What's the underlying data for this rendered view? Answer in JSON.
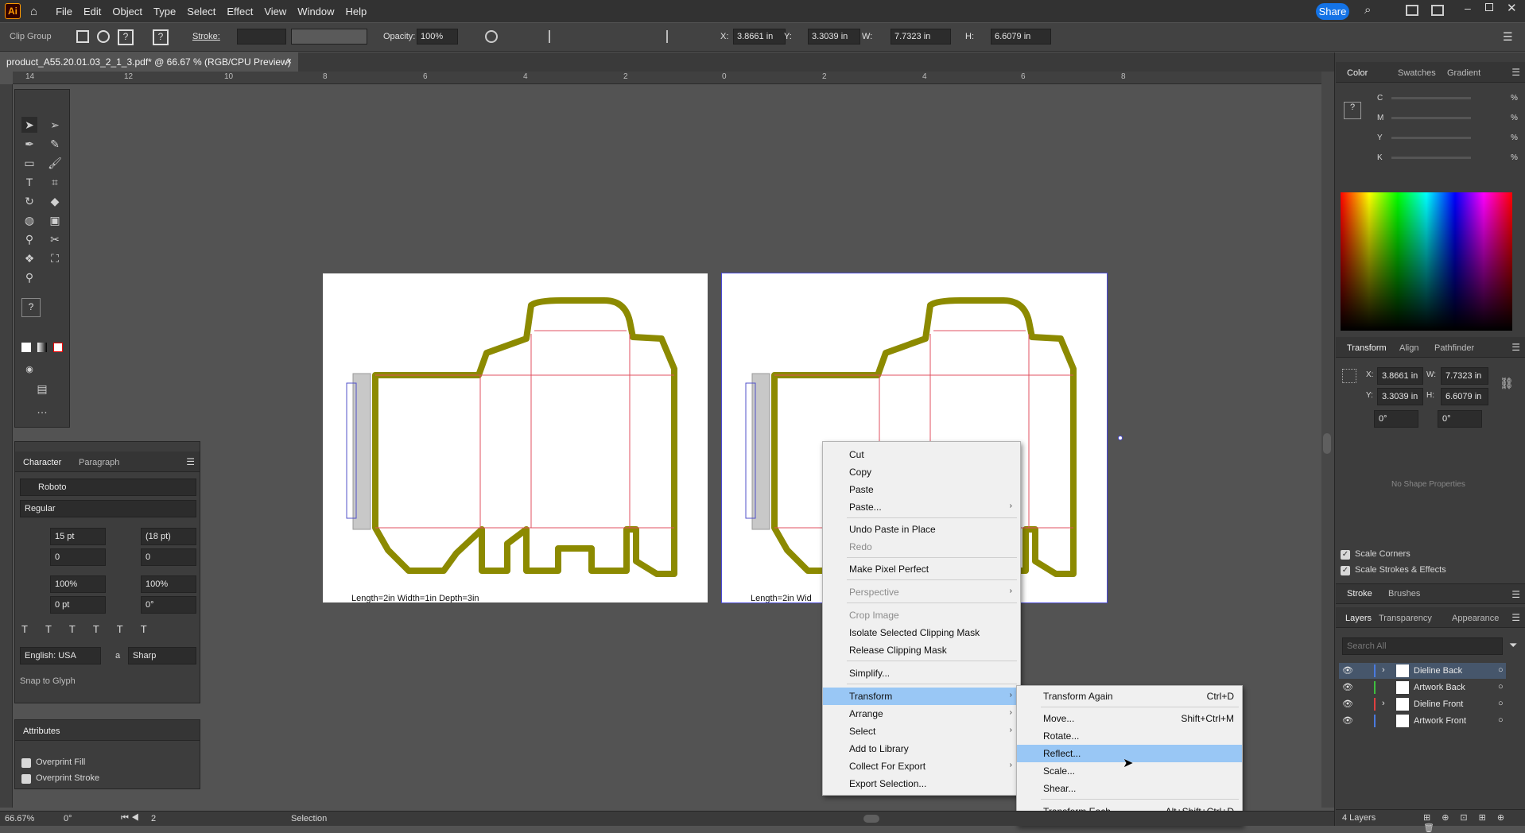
{
  "app": {
    "logo": "Ai",
    "share": "Share"
  },
  "menu": [
    "File",
    "Edit",
    "Object",
    "Type",
    "Select",
    "Effect",
    "View",
    "Window",
    "Help"
  ],
  "control": {
    "selection": "Clip Group",
    "stroke_label": "Stroke:",
    "opacity_label": "Opacity:",
    "opacity": "100%",
    "x_label": "X:",
    "x": "3.8661 in",
    "y_label": "Y:",
    "y": "3.3039 in",
    "w_label": "W:",
    "w": "7.7323 in",
    "h_label": "H:",
    "h": "6.6079 in"
  },
  "document": {
    "tab": "product_A55.20.01.03_2_1_3.pdf* @ 66.67 % (RGB/CPU Preview)",
    "close": "×"
  },
  "ruler": [
    "14",
    "12",
    "10",
    "8",
    "6",
    "4",
    "2",
    "0",
    "2",
    "4",
    "6",
    "8"
  ],
  "character": {
    "tabs": [
      "Character",
      "Paragraph"
    ],
    "font": "Roboto",
    "style": "Regular",
    "size": "15 pt",
    "leading": "(18 pt)",
    "kerning": "0",
    "tracking": "0",
    "vscale": "100%",
    "hscale": "100%",
    "baseline": "0 pt",
    "rotation": "0°",
    "language": "English: USA",
    "aa_label": "a",
    "antialias": "Sharp",
    "snap": "Snap to Glyph"
  },
  "attributes": {
    "title": "Attributes",
    "overprint_fill": "Overprint Fill",
    "overprint_stroke": "Overprint Stroke"
  },
  "artboard": {
    "caption": "Length=2in Width=1in Depth=3in",
    "caption2": "Length=2in Wid"
  },
  "context_menu": {
    "items": [
      "Cut",
      "Copy",
      "Paste",
      "Paste...",
      "Undo Paste in Place",
      "Redo",
      "Make Pixel Perfect",
      "Perspective",
      "Crop Image",
      "Isolate Selected Clipping Mask",
      "Release Clipping Mask",
      "Simplify...",
      "Transform",
      "Arrange",
      "Select",
      "Add to Library",
      "Collect For Export",
      "Export Selection..."
    ]
  },
  "submenu": {
    "items": [
      {
        "label": "Transform Again",
        "shortcut": "Ctrl+D"
      },
      {
        "label": "Move...",
        "shortcut": "Shift+Ctrl+M"
      },
      {
        "label": "Rotate...",
        "shortcut": ""
      },
      {
        "label": "Reflect...",
        "shortcut": ""
      },
      {
        "label": "Scale...",
        "shortcut": ""
      },
      {
        "label": "Shear...",
        "shortcut": ""
      },
      {
        "label": "Transform Each...",
        "shortcut": "Alt+Shift+Ctrl+D"
      }
    ]
  },
  "color_panel": {
    "tabs": [
      "Color",
      "Swatches",
      "Gradient"
    ],
    "channels": [
      "C",
      "M",
      "Y",
      "K"
    ],
    "pct": "%",
    "unknown": "?"
  },
  "transform_panel": {
    "tabs": [
      "Transform",
      "Align",
      "Pathfinder"
    ],
    "x_label": "X:",
    "x": "3.8661 in",
    "w_label": "W:",
    "w": "7.7323 in",
    "y_label": "Y:",
    "y": "3.3039 in",
    "h_label": "H:",
    "h": "6.6079 in",
    "angle": "0°",
    "shear": "0°",
    "empty": "No Shape Properties",
    "scale_corners": "Scale Corners",
    "scale_strokes": "Scale Strokes & Effects"
  },
  "stroke_panel": {
    "tabs": [
      "Stroke",
      "Brushes"
    ]
  },
  "layers_panel": {
    "tabs": [
      "Layers",
      "Transparency",
      "Appearance"
    ],
    "search": "Search All",
    "layers": [
      "Dieline Back",
      "Artwork Back",
      "Dieline Front",
      "Artwork Front"
    ],
    "count": "4 Layers"
  },
  "status": {
    "zoom": "66.67%",
    "rotate": "0°",
    "page": "2",
    "mode": "Selection"
  },
  "colors": {
    "bg": "#535353",
    "panel": "#3d3d3d",
    "highlight": "#99c7f5",
    "dieline": "#8c8a00",
    "redline": "#e05060",
    "blueline": "#5050c8"
  }
}
